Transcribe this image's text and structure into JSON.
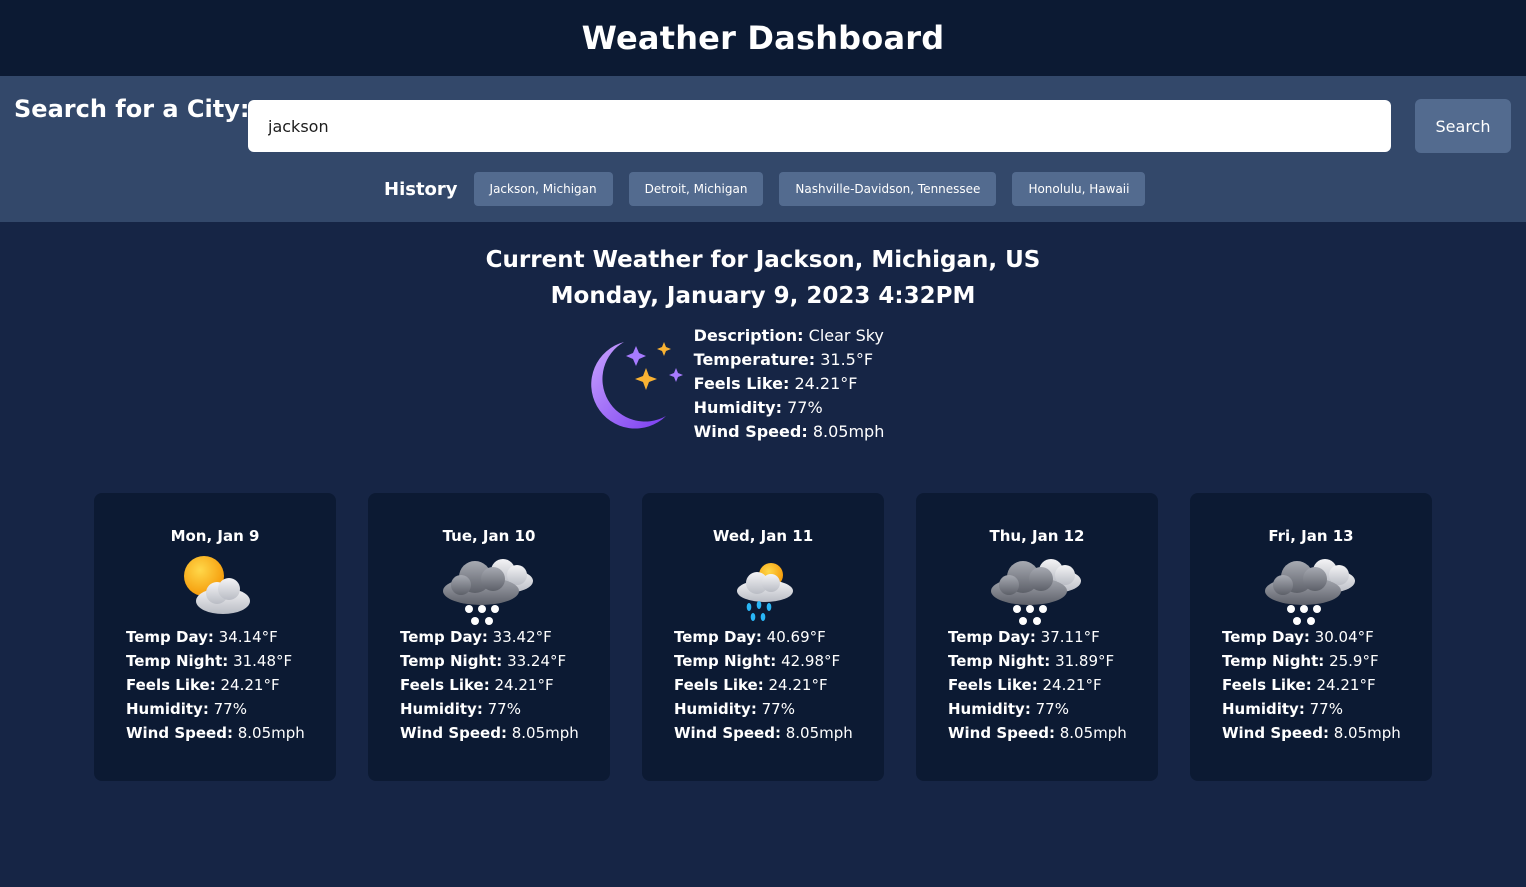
{
  "header": {
    "title": "Weather Dashboard"
  },
  "search": {
    "label": "Search for a City:",
    "value": "jackson",
    "button_label": "Search"
  },
  "history": {
    "label": "History",
    "items": [
      "Jackson, Michigan",
      "Detroit, Michigan",
      "Nashville-Davidson, Tennessee",
      "Honolulu, Hawaii"
    ]
  },
  "current": {
    "heading": "Current Weather for Jackson, Michigan, US",
    "datetime": "Monday, January 9, 2023 4:32PM",
    "icon": "moon-stars-icon",
    "fields": {
      "description_label": "Description:",
      "description": "Clear Sky",
      "temperature_label": "Temperature:",
      "temperature": "31.5°F",
      "feels_like_label": "Feels Like:",
      "feels_like": "24.21°F",
      "humidity_label": "Humidity:",
      "humidity": "77%",
      "wind_label": "Wind Speed:",
      "wind": "8.05mph"
    }
  },
  "forecast_labels": {
    "temp_day": "Temp Day:",
    "temp_night": "Temp Night:",
    "feels_like": "Feels Like:",
    "humidity": "Humidity:",
    "wind": "Wind Speed:"
  },
  "forecast": [
    {
      "date": "Mon, Jan 9",
      "icon": "partly-sunny-icon",
      "temp_day": "34.14°F",
      "temp_night": "31.48°F",
      "feels_like": "24.21°F",
      "humidity": "77%",
      "wind": "8.05mph"
    },
    {
      "date": "Tue, Jan 10",
      "icon": "snow-cloud-icon",
      "temp_day": "33.42°F",
      "temp_night": "33.24°F",
      "feels_like": "24.21°F",
      "humidity": "77%",
      "wind": "8.05mph"
    },
    {
      "date": "Wed, Jan 11",
      "icon": "sun-rain-cloud-icon",
      "temp_day": "40.69°F",
      "temp_night": "42.98°F",
      "feels_like": "24.21°F",
      "humidity": "77%",
      "wind": "8.05mph"
    },
    {
      "date": "Thu, Jan 12",
      "icon": "snow-cloud-icon",
      "temp_day": "37.11°F",
      "temp_night": "31.89°F",
      "feels_like": "24.21°F",
      "humidity": "77%",
      "wind": "8.05mph"
    },
    {
      "date": "Fri, Jan 13",
      "icon": "snow-cloud-icon",
      "temp_day": "30.04°F",
      "temp_night": "25.9°F",
      "feels_like": "24.21°F",
      "humidity": "77%",
      "wind": "8.05mph"
    }
  ]
}
